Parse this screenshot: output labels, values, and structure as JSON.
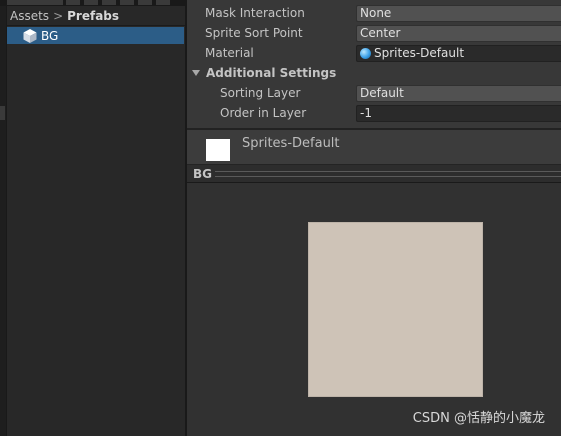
{
  "project": {
    "breadcrumb": [
      "Assets",
      "Prefabs"
    ],
    "items": [
      {
        "label": "BG",
        "icon": "prefab-cube-icon",
        "selected": true
      }
    ]
  },
  "inspector": {
    "rows": [
      {
        "label": "Mask Interaction",
        "value": "None"
      },
      {
        "label": "Sprite Sort Point",
        "value": "Center"
      },
      {
        "label": "Material",
        "value": "Sprites-Default",
        "icon": "material-sphere-icon"
      }
    ],
    "additional_settings": {
      "label": "Additional Settings",
      "rows": [
        {
          "label": "Sorting Layer",
          "value": "Default"
        },
        {
          "label": "Order in Layer",
          "value": "-1"
        }
      ]
    }
  },
  "material": {
    "name": "Sprites-Default",
    "swatch_color": "#ffffff"
  },
  "preview": {
    "title": "BG",
    "sprite_color": "#cec3b7"
  },
  "watermark": "CSDN @恬静的小魔龙",
  "colors": {
    "selection": "#2c5d87",
    "inspector_bg": "#383838",
    "dropdown_bg": "#515151"
  }
}
